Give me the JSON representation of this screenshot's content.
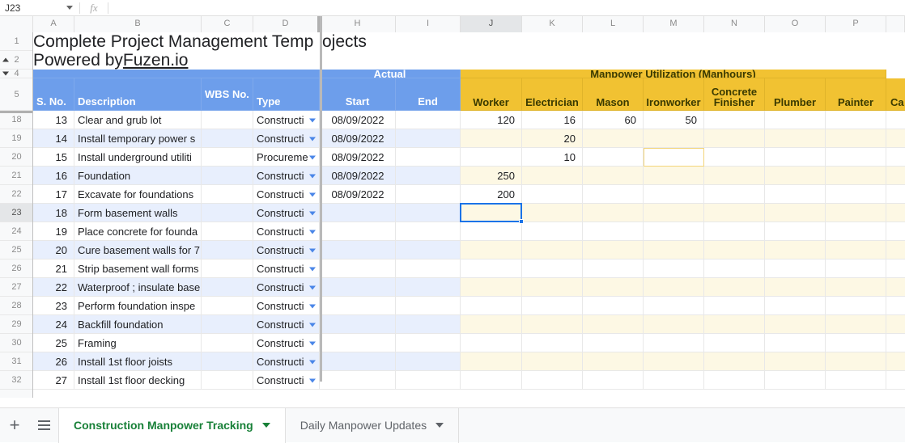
{
  "formula_bar": {
    "name_box": "J23",
    "fx_label": "fx",
    "formula_value": "",
    "formula_placeholder": ""
  },
  "grid": {
    "column_letters": [
      "A",
      "B",
      "C",
      "D",
      "H",
      "I",
      "J",
      "K",
      "L",
      "M",
      "N",
      "O",
      "P"
    ],
    "selected_column": "J",
    "row_numbers": [
      "1",
      "2",
      "4",
      "5",
      "18",
      "19",
      "20",
      "21",
      "22",
      "23",
      "24",
      "25",
      "26",
      "27",
      "28",
      "29",
      "30",
      "31",
      "32"
    ],
    "selected_row": "23"
  },
  "title": {
    "line1": "Complete Project Management Temp",
    "line1_overflow": "ojects",
    "line2_prefix": "Powered by ",
    "line2_link": "Fuzen.io"
  },
  "headers": {
    "group_actual": "Actual",
    "group_manpower": "Manpower Utilization (Manhours)",
    "col_sno": "S. No.",
    "col_description": "Description",
    "col_wbs": "WBS No.",
    "col_type": "Type",
    "col_start": "Start",
    "col_end": "End",
    "col_worker": "Worker",
    "col_electrician": "Electrician",
    "col_mason": "Mason",
    "col_ironworker": "Ironworker",
    "col_concrete_finisher": "Concrete Finisher",
    "col_plumber": "Plumber",
    "col_painter": "Painter",
    "col_carpenter_clipped": "Ca"
  },
  "rows": [
    {
      "row": "18",
      "sno": "13",
      "description": "Clear and grub lot",
      "wbs": "",
      "type": "Constructi",
      "start": "08/09/2022",
      "end": "",
      "worker": "120",
      "electrician": "16",
      "mason": "60",
      "ironworker": "50",
      "concrete_finisher": "",
      "plumber": "",
      "painter": ""
    },
    {
      "row": "19",
      "sno": "14",
      "description": "Install temporary power s",
      "wbs": "",
      "type": "Constructi",
      "start": "08/09/2022",
      "end": "",
      "worker": "",
      "electrician": "20",
      "mason": "",
      "ironworker": "",
      "concrete_finisher": "",
      "plumber": "",
      "painter": ""
    },
    {
      "row": "20",
      "sno": "15",
      "description": "Install underground utiliti",
      "wbs": "",
      "type": "Procureme",
      "start": "08/09/2022",
      "end": "",
      "worker": "",
      "electrician": "10",
      "mason": "",
      "ironworker": "",
      "concrete_finisher": "",
      "plumber": "",
      "painter": ""
    },
    {
      "row": "21",
      "sno": "16",
      "description": "Foundation",
      "wbs": "",
      "type": "Constructi",
      "start": "08/09/2022",
      "end": "",
      "worker": "250",
      "electrician": "",
      "mason": "",
      "ironworker": "",
      "concrete_finisher": "",
      "plumber": "",
      "painter": ""
    },
    {
      "row": "22",
      "sno": "17",
      "description": "Excavate for foundations",
      "wbs": "",
      "type": "Constructi",
      "start": "08/09/2022",
      "end": "",
      "worker": "200",
      "electrician": "",
      "mason": "",
      "ironworker": "",
      "concrete_finisher": "",
      "plumber": "",
      "painter": ""
    },
    {
      "row": "23",
      "sno": "18",
      "description": "Form basement walls",
      "wbs": "",
      "type": "Constructi",
      "start": "",
      "end": "",
      "worker": "",
      "electrician": "",
      "mason": "",
      "ironworker": "",
      "concrete_finisher": "",
      "plumber": "",
      "painter": ""
    },
    {
      "row": "24",
      "sno": "19",
      "description": "Place concrete for founda",
      "wbs": "",
      "type": "Constructi",
      "start": "",
      "end": "",
      "worker": "",
      "electrician": "",
      "mason": "",
      "ironworker": "",
      "concrete_finisher": "",
      "plumber": "",
      "painter": ""
    },
    {
      "row": "25",
      "sno": "20",
      "description": "Cure basement walls for 7",
      "wbs": "",
      "type": "Constructi",
      "start": "",
      "end": "",
      "worker": "",
      "electrician": "",
      "mason": "",
      "ironworker": "",
      "concrete_finisher": "",
      "plumber": "",
      "painter": ""
    },
    {
      "row": "26",
      "sno": "21",
      "description": "Strip basement wall forms",
      "wbs": "",
      "type": "Constructi",
      "start": "",
      "end": "",
      "worker": "",
      "electrician": "",
      "mason": "",
      "ironworker": "",
      "concrete_finisher": "",
      "plumber": "",
      "painter": ""
    },
    {
      "row": "27",
      "sno": "22",
      "description": "Waterproof ; insulate base",
      "wbs": "",
      "type": "Constructi",
      "start": "",
      "end": "",
      "worker": "",
      "electrician": "",
      "mason": "",
      "ironworker": "",
      "concrete_finisher": "",
      "plumber": "",
      "painter": ""
    },
    {
      "row": "28",
      "sno": "23",
      "description": "Perform foundation inspe",
      "wbs": "",
      "type": "Constructi",
      "start": "",
      "end": "",
      "worker": "",
      "electrician": "",
      "mason": "",
      "ironworker": "",
      "concrete_finisher": "",
      "plumber": "",
      "painter": ""
    },
    {
      "row": "29",
      "sno": "24",
      "description": "Backfill foundation",
      "wbs": "",
      "type": "Constructi",
      "start": "",
      "end": "",
      "worker": "",
      "electrician": "",
      "mason": "",
      "ironworker": "",
      "concrete_finisher": "",
      "plumber": "",
      "painter": ""
    },
    {
      "row": "30",
      "sno": "25",
      "description": "Framing",
      "wbs": "",
      "type": "Constructi",
      "start": "",
      "end": "",
      "worker": "",
      "electrician": "",
      "mason": "",
      "ironworker": "",
      "concrete_finisher": "",
      "plumber": "",
      "painter": ""
    },
    {
      "row": "31",
      "sno": "26",
      "description": "Install 1st floor joists",
      "wbs": "",
      "type": "Constructi",
      "start": "",
      "end": "",
      "worker": "",
      "electrician": "",
      "mason": "",
      "ironworker": "",
      "concrete_finisher": "",
      "plumber": "",
      "painter": ""
    },
    {
      "row": "32",
      "sno": "27",
      "description": "Install 1st floor decking",
      "wbs": "",
      "type": "Constructi",
      "start": "",
      "end": "",
      "worker": "",
      "electrician": "",
      "mason": "",
      "ironworker": "",
      "concrete_finisher": "",
      "plumber": "",
      "painter": ""
    }
  ],
  "tabs": {
    "add_label": "+",
    "all_sheets_label": "",
    "sheets": [
      {
        "label": "Construction Manpower Tracking",
        "active": true
      },
      {
        "label": "Daily Manpower Updates",
        "active": false
      }
    ]
  },
  "colors": {
    "header_blue": "#6d9eeb",
    "header_gold": "#f1c232",
    "band_blue": "#e8effd",
    "band_cream": "#fdf8e4",
    "selection": "#1a73e8",
    "active_tab_text": "#188038"
  }
}
